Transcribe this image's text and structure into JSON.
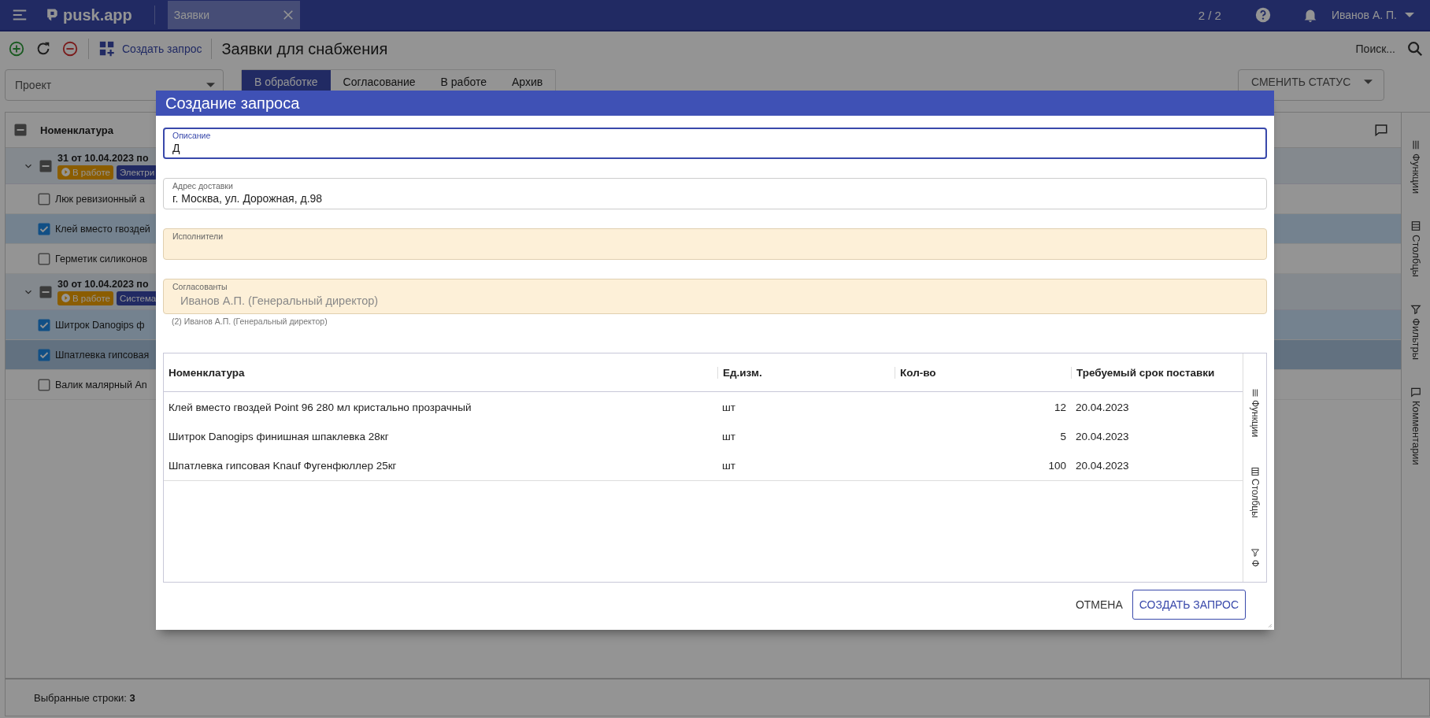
{
  "app": {
    "logo": "pusk.app",
    "tabs": [
      {
        "label": "Заявки",
        "selected": true
      }
    ],
    "counter": "2 / 2",
    "user": "Иванов А. П."
  },
  "toolbar": {
    "create_label": "Создать запрос",
    "title": "Заявки для снабжения",
    "search_placeholder": "Поиск..."
  },
  "filters": {
    "project_placeholder": "Проект",
    "status_tabs": [
      {
        "label": "В обработке",
        "selected": true
      },
      {
        "label": "Согласование",
        "selected": false
      },
      {
        "label": "В работе",
        "selected": false
      },
      {
        "label": "Архив",
        "selected": false
      }
    ],
    "change_status": "СМЕНИТЬ СТАТУС"
  },
  "grid": {
    "column": "Номенклатура",
    "header_indeterminate": true,
    "groups": [
      {
        "title": "31 от 10.04.2023 по",
        "expanded": true,
        "indeterminate": true,
        "status": "В работе",
        "tag": "Электри",
        "items": [
          {
            "name": "Люк ревизионный а",
            "checked": false,
            "focused": false
          },
          {
            "name": "Клей вместо гвоздей",
            "checked": true,
            "focused": false
          },
          {
            "name": "Герметик силиконов",
            "checked": false,
            "focused": false
          }
        ]
      },
      {
        "title": "30 от 10.04.2023 по",
        "expanded": true,
        "indeterminate": true,
        "status": "В работе",
        "tag": "Система",
        "items": [
          {
            "name": "Шитрок Danogips ф",
            "checked": true,
            "focused": false
          },
          {
            "name": "Шпатлевка гипсовая",
            "checked": true,
            "focused": true
          },
          {
            "name": "Валик малярный An",
            "checked": false,
            "focused": false
          }
        ]
      }
    ]
  },
  "side_panel": [
    "Функции",
    "Столбцы",
    "Фильтры",
    "Комментарии"
  ],
  "status_bar": {
    "label": "Выбранные строки:",
    "count": "3"
  },
  "dialog": {
    "title": "Создание запроса",
    "fields": [
      {
        "label": "Описание",
        "value": "Д",
        "focused": true,
        "highlighted": false,
        "disabled": false
      },
      {
        "label": "Адрес доставки",
        "value": "г. Москва, ул. Дорожная, д.98",
        "focused": false,
        "highlighted": false,
        "disabled": false
      },
      {
        "label": "Исполнители",
        "focused": false,
        "highlighted": true,
        "disabled": false
      },
      {
        "label": "Согласованты",
        "value": "Иванов А.П. (Генеральный директор)",
        "helper": "(2) Иванов А.П. (Генеральный директор)",
        "focused": false,
        "highlighted": true,
        "disabled": true
      }
    ],
    "table": {
      "columns": [
        "Номенклатура",
        "Ед.изм.",
        "Кол-во",
        "Требуемый срок поставки"
      ],
      "rows": [
        [
          "Клей вместо гвоздей Point 96 280 мл кристально прозрачный",
          "шт",
          "12",
          "20.04.2023"
        ],
        [
          "Шитрок Danogips финишная шпаклевка 28кг",
          "шт",
          "5",
          "20.04.2023"
        ],
        [
          "Шпатлевка гипсовая Knauf Фугенфюллер 25кг",
          "шт",
          "100",
          "20.04.2023"
        ]
      ],
      "side_panel": [
        "Функции",
        "Столбцы",
        "Ф"
      ]
    },
    "buttons": [
      {
        "label": "ОТМЕНА",
        "kind": "text"
      },
      {
        "label": "СОЗДАТЬ ЗАПРОС",
        "kind": "outlined"
      }
    ]
  }
}
